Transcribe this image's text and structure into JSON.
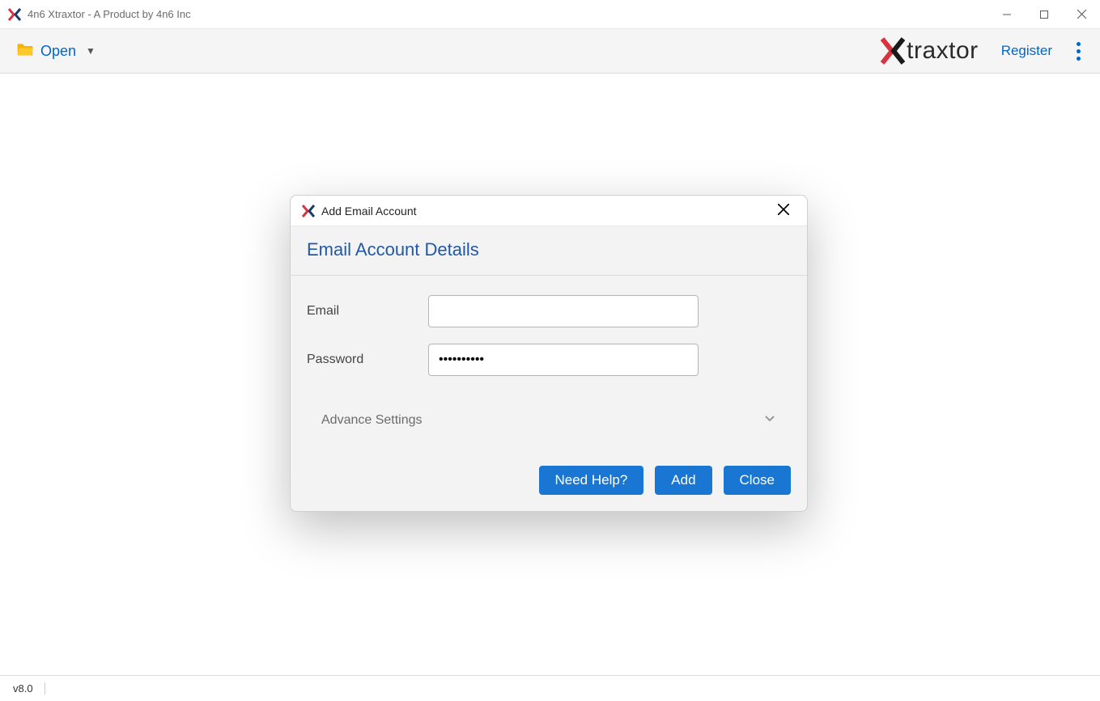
{
  "window": {
    "title": "4n6 Xtraxtor - A Product by 4n6 Inc"
  },
  "toolbar": {
    "open_label": "Open",
    "logo_text": "traxtor",
    "register_label": "Register"
  },
  "modal": {
    "title": "Add Email Account",
    "heading": "Email Account Details",
    "email_label": "Email",
    "email_value": "",
    "password_label": "Password",
    "password_value": "••••••••••",
    "advance_label": "Advance Settings",
    "buttons": {
      "need_help": "Need Help?",
      "add": "Add",
      "close": "Close"
    }
  },
  "status": {
    "version": "v8.0"
  }
}
